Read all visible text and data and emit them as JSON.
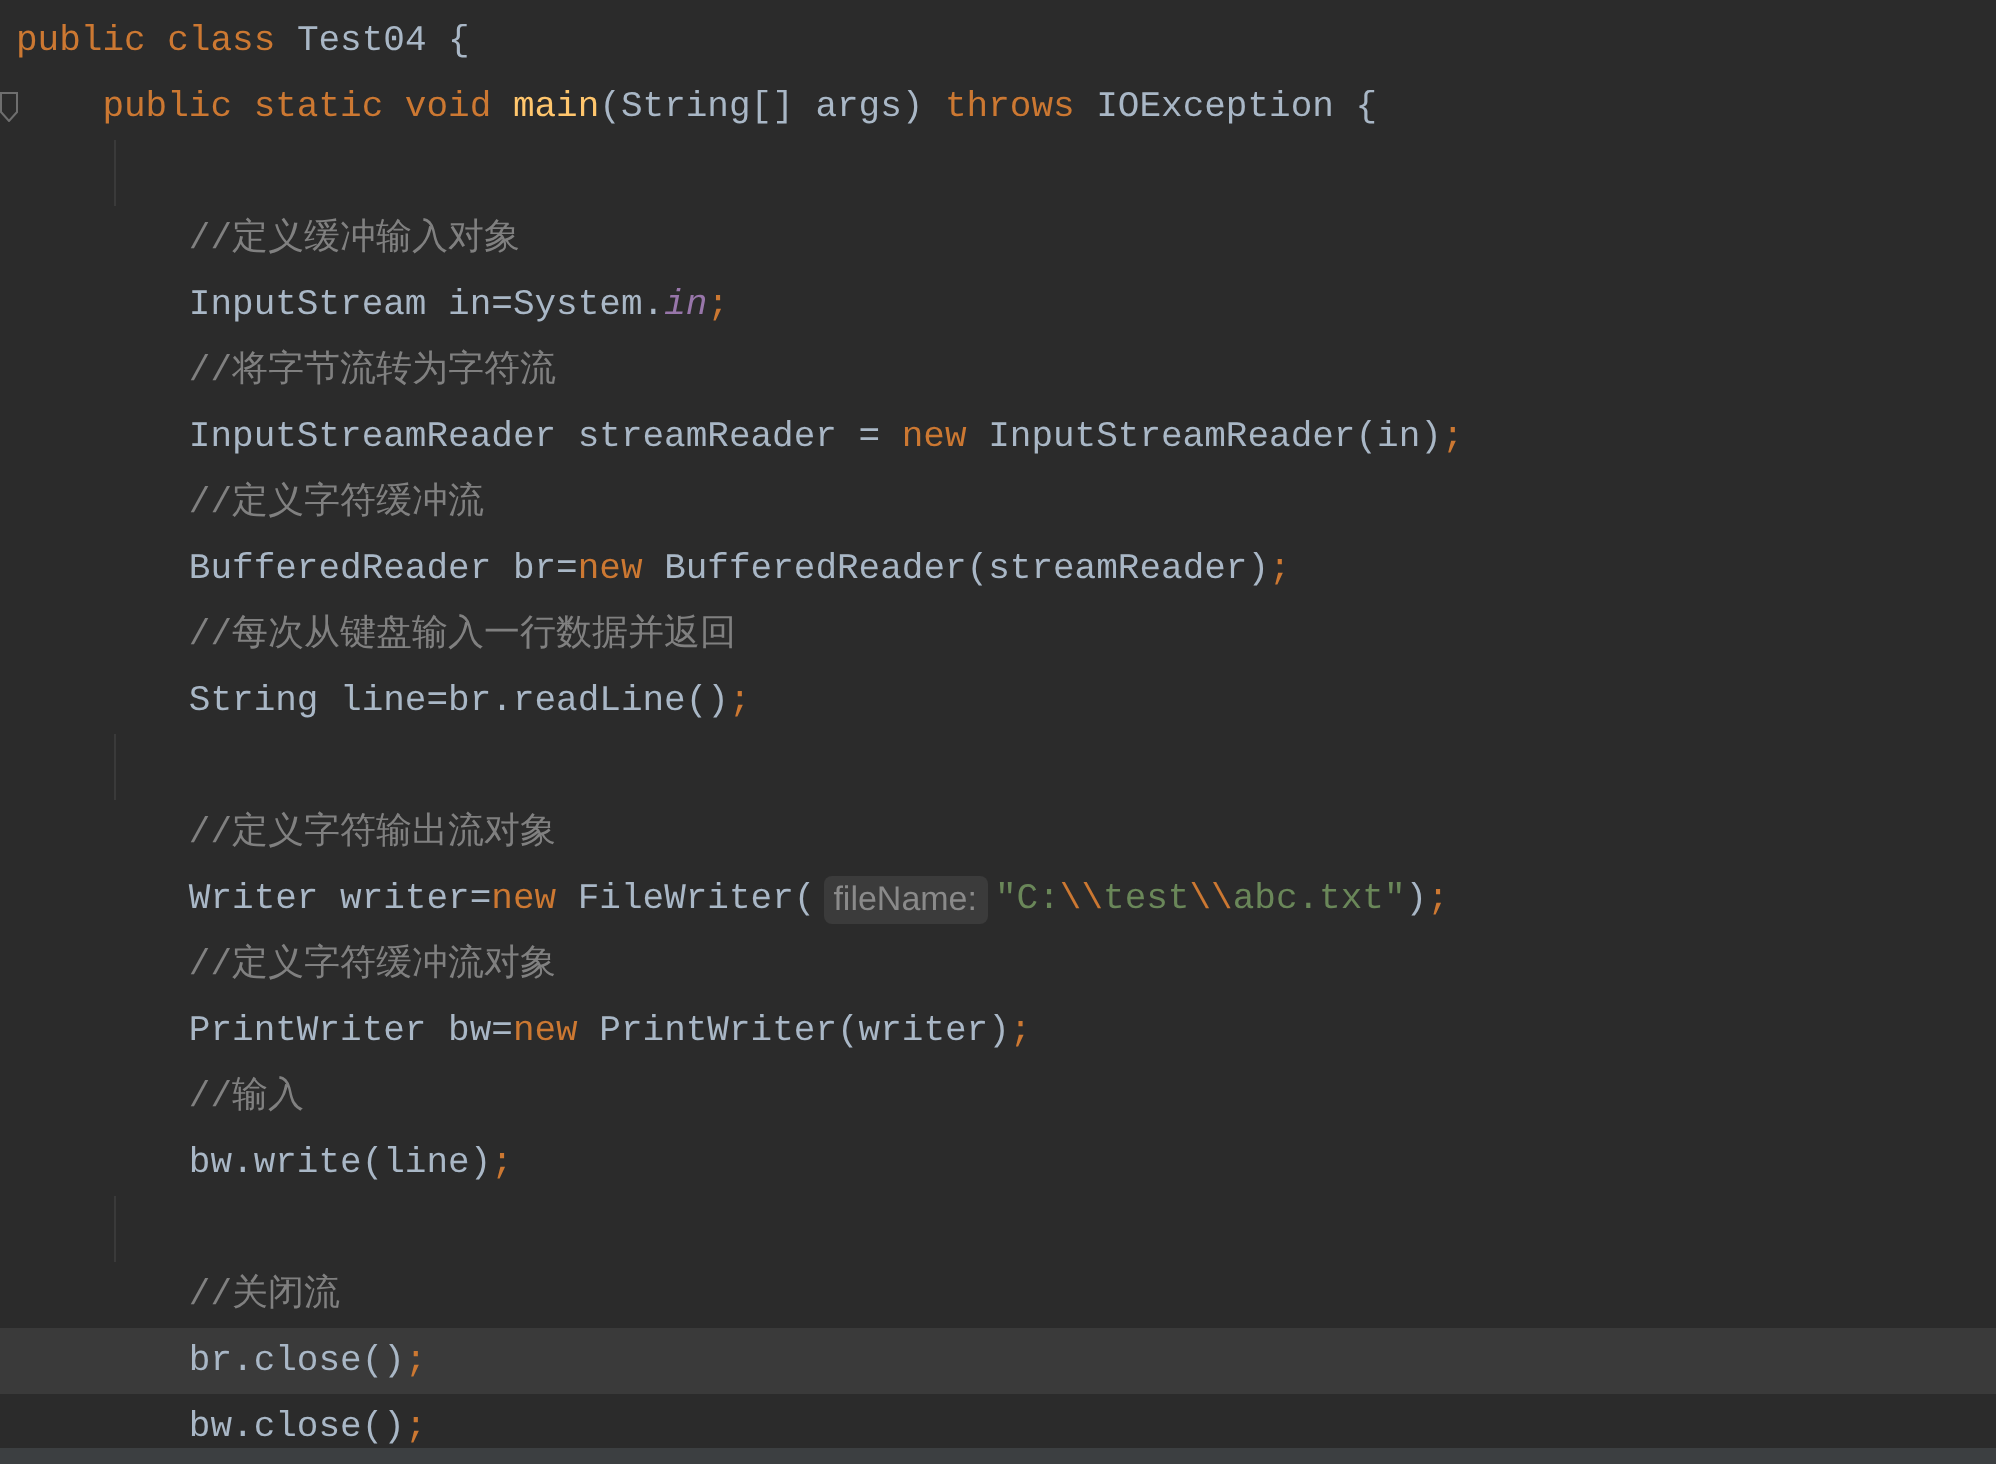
{
  "editor": {
    "lines": [
      {
        "kind": "code",
        "current": false,
        "tokens": [
          {
            "kind": "kw",
            "t": "public class "
          },
          {
            "kind": "plain",
            "t": "Test04 {"
          }
        ]
      },
      {
        "kind": "code",
        "current": false,
        "fold": true,
        "tokens": [
          {
            "kind": "kw",
            "t": "    public static void "
          },
          {
            "kind": "method",
            "t": "main"
          },
          {
            "kind": "plain",
            "t": "(String[] args) "
          },
          {
            "kind": "kw",
            "t": "throws "
          },
          {
            "kind": "plain",
            "t": "IOException {"
          }
        ]
      },
      {
        "kind": "blank",
        "current": false
      },
      {
        "kind": "code",
        "current": false,
        "tokens": [
          {
            "kind": "comment",
            "t": "        //定义缓冲输入对象"
          }
        ]
      },
      {
        "kind": "code",
        "current": false,
        "tokens": [
          {
            "kind": "plain",
            "t": "        InputStream in=System."
          },
          {
            "kind": "field",
            "t": "in"
          },
          {
            "kind": "kw",
            "t": ";"
          }
        ]
      },
      {
        "kind": "code",
        "current": false,
        "tokens": [
          {
            "kind": "comment",
            "t": "        //将字节流转为字符流"
          }
        ]
      },
      {
        "kind": "code",
        "current": false,
        "tokens": [
          {
            "kind": "plain",
            "t": "        InputStreamReader streamReader = "
          },
          {
            "kind": "kw",
            "t": "new "
          },
          {
            "kind": "plain",
            "t": "InputStreamReader(in)"
          },
          {
            "kind": "kw",
            "t": ";"
          }
        ]
      },
      {
        "kind": "code",
        "current": false,
        "tokens": [
          {
            "kind": "comment",
            "t": "        //定义字符缓冲流"
          }
        ]
      },
      {
        "kind": "code",
        "current": false,
        "tokens": [
          {
            "kind": "plain",
            "t": "        BufferedReader br="
          },
          {
            "kind": "kw",
            "t": "new "
          },
          {
            "kind": "plain",
            "t": "BufferedReader(streamReader)"
          },
          {
            "kind": "kw",
            "t": ";"
          }
        ]
      },
      {
        "kind": "code",
        "current": false,
        "tokens": [
          {
            "kind": "comment",
            "t": "        //每次从键盘输入一行数据并返回"
          }
        ]
      },
      {
        "kind": "code",
        "current": false,
        "tokens": [
          {
            "kind": "plain",
            "t": "        String line=br.readLine()"
          },
          {
            "kind": "kw",
            "t": ";"
          }
        ]
      },
      {
        "kind": "blank",
        "current": false
      },
      {
        "kind": "code",
        "current": false,
        "tokens": [
          {
            "kind": "comment",
            "t": "        //定义字符输出流对象"
          }
        ]
      },
      {
        "kind": "code",
        "current": false,
        "tokens": [
          {
            "kind": "plain",
            "t": "        Writer writer="
          },
          {
            "kind": "kw",
            "t": "new "
          },
          {
            "kind": "plain",
            "t": "FileWriter("
          },
          {
            "kind": "hint",
            "t": "fileName:"
          },
          {
            "kind": "string",
            "t": "\"C:"
          },
          {
            "kind": "kw",
            "t": "\\\\"
          },
          {
            "kind": "string",
            "t": "test"
          },
          {
            "kind": "kw",
            "t": "\\\\"
          },
          {
            "kind": "string",
            "t": "abc.txt\""
          },
          {
            "kind": "plain",
            "t": ")"
          },
          {
            "kind": "kw",
            "t": ";"
          }
        ]
      },
      {
        "kind": "code",
        "current": false,
        "tokens": [
          {
            "kind": "comment",
            "t": "        //定义字符缓冲流对象"
          }
        ]
      },
      {
        "kind": "code",
        "current": false,
        "tokens": [
          {
            "kind": "plain",
            "t": "        PrintWriter bw="
          },
          {
            "kind": "kw",
            "t": "new "
          },
          {
            "kind": "plain",
            "t": "PrintWriter(writer)"
          },
          {
            "kind": "kw",
            "t": ";"
          }
        ]
      },
      {
        "kind": "code",
        "current": false,
        "tokens": [
          {
            "kind": "comment",
            "t": "        //输入"
          }
        ]
      },
      {
        "kind": "code",
        "current": false,
        "tokens": [
          {
            "kind": "plain",
            "t": "        bw.write(line)"
          },
          {
            "kind": "kw",
            "t": ";"
          }
        ]
      },
      {
        "kind": "blank",
        "current": false
      },
      {
        "kind": "code",
        "current": false,
        "tokens": [
          {
            "kind": "comment",
            "t": "        //关闭流"
          }
        ]
      },
      {
        "kind": "code",
        "current": true,
        "tokens": [
          {
            "kind": "plain",
            "t": "        br.close()"
          },
          {
            "kind": "kw",
            "t": ";"
          }
        ]
      },
      {
        "kind": "code",
        "current": false,
        "tokens": [
          {
            "kind": "plain",
            "t": "        bw.close()"
          },
          {
            "kind": "kw",
            "t": ";"
          }
        ]
      }
    ]
  }
}
